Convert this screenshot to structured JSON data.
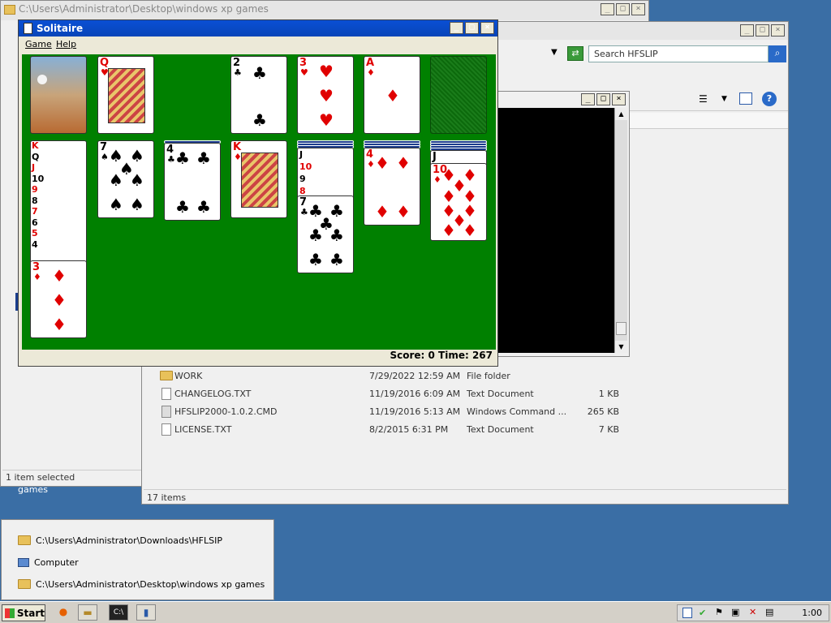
{
  "back_explorer": {
    "title": "C:\\Users\\Administrator\\Desktop\\windows xp games",
    "status": "1 item selected",
    "desktop_label": "games"
  },
  "explorer": {
    "search_placeholder": "Search HFSLIP",
    "status": "17 items",
    "files": [
      {
        "name": "WORK",
        "date": "7/29/2022 12:59 AM",
        "type": "File folder",
        "size": "",
        "icon": "folder-icon"
      },
      {
        "name": "CHANGELOG.TXT",
        "date": "11/19/2016 6:09 AM",
        "type": "Text Document",
        "size": "1 KB",
        "icon": "text-file-icon"
      },
      {
        "name": "HFSLIP2000-1.0.2.CMD",
        "date": "11/19/2016 5:13 AM",
        "type": "Windows Command ...",
        "size": "265 KB",
        "icon": "cmd-file-icon"
      },
      {
        "name": "LICENSE.TXT",
        "date": "8/2/2015 6:31 PM",
        "type": "Text Document",
        "size": "7 KB",
        "icon": "text-file-icon"
      }
    ]
  },
  "solitaire": {
    "title": "Solitaire",
    "menu": {
      "game": "Game",
      "help": "Help"
    },
    "score_time": "Score: 0 Time: 267",
    "cards": {
      "found_queen": {
        "rank": "Q",
        "suit": "♥"
      },
      "found_two": {
        "rank": "2",
        "suit": "♣"
      },
      "found_three": {
        "rank": "3",
        "suit": "♥"
      },
      "found_ace": {
        "rank": "A",
        "suit": "♦"
      },
      "col1_labels": [
        "K",
        "Q",
        "J",
        "10",
        "9",
        "8",
        "7",
        "6",
        "5",
        "4"
      ],
      "col1_top": {
        "rank": "3",
        "suit": "♦"
      },
      "col2_top": {
        "rank": "7",
        "suit": "♠"
      },
      "col3_top": {
        "rank": "4",
        "suit": "♣"
      },
      "col4_top": {
        "rank": "K",
        "suit": "♦"
      },
      "col5_labels": [
        "J",
        "10",
        "9",
        "8"
      ],
      "col5_top": {
        "rank": "7",
        "suit": "♣"
      },
      "col6_top": {
        "rank": "4",
        "suit": "♦"
      },
      "col7_labels": [
        "J"
      ],
      "col7_top": {
        "rank": "10",
        "suit": "♦"
      }
    }
  },
  "quick_launch": [
    {
      "label": "C:\\Users\\Administrator\\Downloads\\HFLSIP",
      "icon": "folder-icon"
    },
    {
      "label": "Computer",
      "icon": "computer-icon"
    },
    {
      "label": "C:\\Users\\Administrator\\Desktop\\windows xp games",
      "icon": "folder-icon"
    }
  ],
  "taskbar": {
    "start": "Start",
    "clock": "1:00"
  }
}
